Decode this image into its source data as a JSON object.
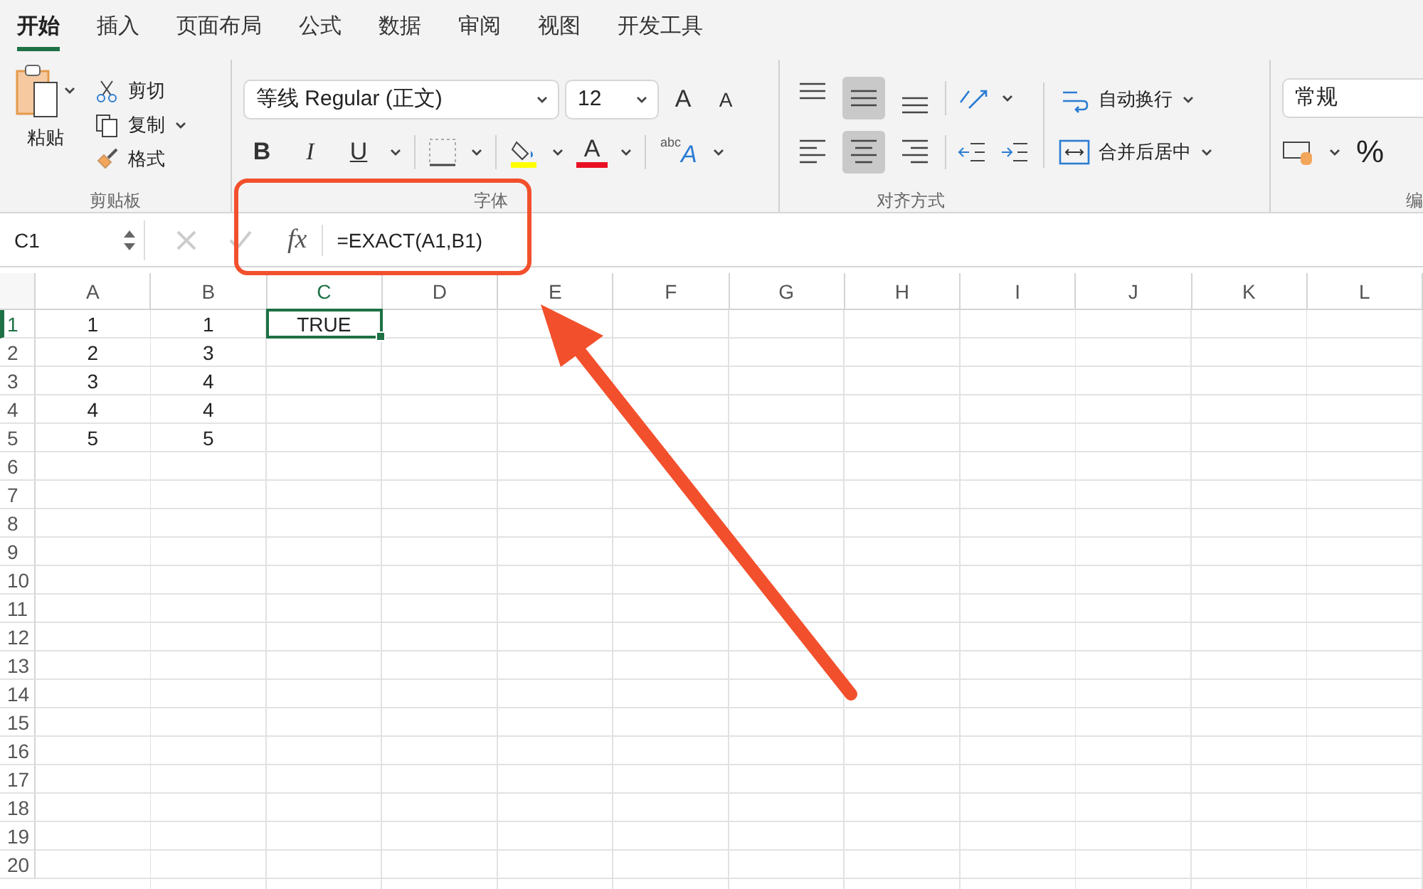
{
  "tabs": [
    {
      "label": "开始",
      "selected": true
    },
    {
      "label": "插入",
      "selected": false
    },
    {
      "label": "页面布局",
      "selected": false
    },
    {
      "label": "公式",
      "selected": false
    },
    {
      "label": "数据",
      "selected": false
    },
    {
      "label": "审阅",
      "selected": false
    },
    {
      "label": "视图",
      "selected": false
    },
    {
      "label": "开发工具",
      "selected": false
    }
  ],
  "clipboard": {
    "paste": "粘贴",
    "cut": "剪切",
    "copy": "复制",
    "format": "格式",
    "group_label": "剪贴板"
  },
  "font": {
    "font_name": "等线 Regular (正文)",
    "font_size": "12",
    "grow": "A",
    "shrink": "A",
    "bold": "B",
    "italic": "I",
    "underline": "U",
    "font_color": "A",
    "phonetic": "abc",
    "phonetic_letter": "A",
    "group_label": "字体"
  },
  "alignment": {
    "vertical": [
      {
        "selected": false
      },
      {
        "selected": true
      },
      {
        "selected": false
      }
    ],
    "horizontal": [
      {
        "selected": false
      },
      {
        "selected": true
      },
      {
        "selected": false
      }
    ],
    "wrap_text": "自动换行",
    "merge_center": "合并后居中",
    "group_label": "对齐方式"
  },
  "number": {
    "format": "常规",
    "percent": "%",
    "group_label": "编"
  },
  "formula_bar": {
    "name_box": "C1",
    "fx": "fx",
    "formula": "=EXACT(A1,B1)"
  },
  "grid": {
    "columns": [
      {
        "label": "A",
        "selected": false
      },
      {
        "label": "B",
        "selected": false
      },
      {
        "label": "C",
        "selected": true
      },
      {
        "label": "D",
        "selected": false
      },
      {
        "label": "E",
        "selected": false
      },
      {
        "label": "F",
        "selected": false
      },
      {
        "label": "G",
        "selected": false
      },
      {
        "label": "H",
        "selected": false
      },
      {
        "label": "I",
        "selected": false
      },
      {
        "label": "J",
        "selected": false
      },
      {
        "label": "K",
        "selected": false
      },
      {
        "label": "L",
        "selected": false
      }
    ],
    "rows": [
      {
        "header": "1",
        "selected": true,
        "cells": [
          {
            "value": "1",
            "selected": false
          },
          {
            "value": "1",
            "selected": false
          },
          {
            "value": "TRUE",
            "selected": true
          }
        ]
      },
      {
        "header": "2",
        "selected": false,
        "cells": [
          {
            "value": "2",
            "selected": false
          },
          {
            "value": "3",
            "selected": false
          }
        ]
      },
      {
        "header": "3",
        "selected": false,
        "cells": [
          {
            "value": "3",
            "selected": false
          },
          {
            "value": "4",
            "selected": false
          }
        ]
      },
      {
        "header": "4",
        "selected": false,
        "cells": [
          {
            "value": "4",
            "selected": false
          },
          {
            "value": "4",
            "selected": false
          }
        ]
      },
      {
        "header": "5",
        "selected": false,
        "cells": [
          {
            "value": "5",
            "selected": false
          },
          {
            "value": "5",
            "selected": false
          }
        ]
      },
      {
        "header": "6",
        "selected": false
      },
      {
        "header": "7",
        "selected": false
      },
      {
        "header": "8",
        "selected": false
      },
      {
        "header": "9",
        "selected": false
      },
      {
        "header": "10",
        "selected": false
      },
      {
        "header": "11",
        "selected": false
      },
      {
        "header": "12",
        "selected": false
      },
      {
        "header": "13",
        "selected": false
      },
      {
        "header": "14",
        "selected": false
      },
      {
        "header": "15",
        "selected": false
      },
      {
        "header": "16",
        "selected": false
      },
      {
        "header": "17",
        "selected": false
      },
      {
        "header": "18",
        "selected": false
      },
      {
        "header": "19",
        "selected": false
      },
      {
        "header": "20",
        "selected": false
      }
    ]
  }
}
